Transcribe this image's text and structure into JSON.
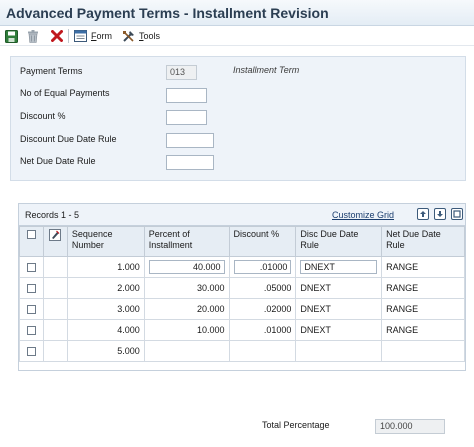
{
  "window": {
    "title": "Advanced Payment Terms - Installment Revision"
  },
  "toolbar": {
    "save_icon": "save-icon",
    "delete_icon": "trash-icon",
    "cancel_icon": "close-icon",
    "form_label_u": "F",
    "form_label_rest": "orm",
    "tools_label_u": "T",
    "tools_label_rest": "ools"
  },
  "header": {
    "payment_terms_label": "Payment Terms",
    "payment_terms_value": "013",
    "payment_terms_desc": "Installment Term",
    "equal_payments_label": "No of Equal Payments",
    "equal_payments_value": "",
    "discount_pct_label": "Discount %",
    "discount_pct_value": "",
    "discount_due_label": "Discount Due Date Rule",
    "discount_due_value": "",
    "net_due_label": "Net Due Date Rule",
    "net_due_value": ""
  },
  "grid": {
    "records_label": "Records 1 - 5",
    "customize_label": "Customize Grid",
    "columns": {
      "seq": "Sequence Number",
      "pct": "Percent of Installment",
      "disc": "Discount %",
      "disc_due": "Disc Due Date Rule",
      "net_due": "Net Due Date Rule"
    },
    "rows": [
      {
        "seq": "1.000",
        "pct": "40.000",
        "disc": ".01000",
        "disc_due": "DNEXT",
        "net_due": "RANGE"
      },
      {
        "seq": "2.000",
        "pct": "30.000",
        "disc": ".05000",
        "disc_due": "DNEXT",
        "net_due": "RANGE"
      },
      {
        "seq": "3.000",
        "pct": "20.000",
        "disc": ".02000",
        "disc_due": "DNEXT",
        "net_due": "RANGE"
      },
      {
        "seq": "4.000",
        "pct": "10.000",
        "disc": ".01000",
        "disc_due": "DNEXT",
        "net_due": "RANGE"
      },
      {
        "seq": "5.000",
        "pct": "",
        "disc": "",
        "disc_due": "",
        "net_due": ""
      }
    ]
  },
  "totals": {
    "label": "Total Percentage",
    "value": "100.000"
  },
  "colors": {
    "title": "#2b3e52",
    "panel_bg": "#eef3f9",
    "link": "#1a3d6e",
    "cancel_red": "#c0181e"
  }
}
